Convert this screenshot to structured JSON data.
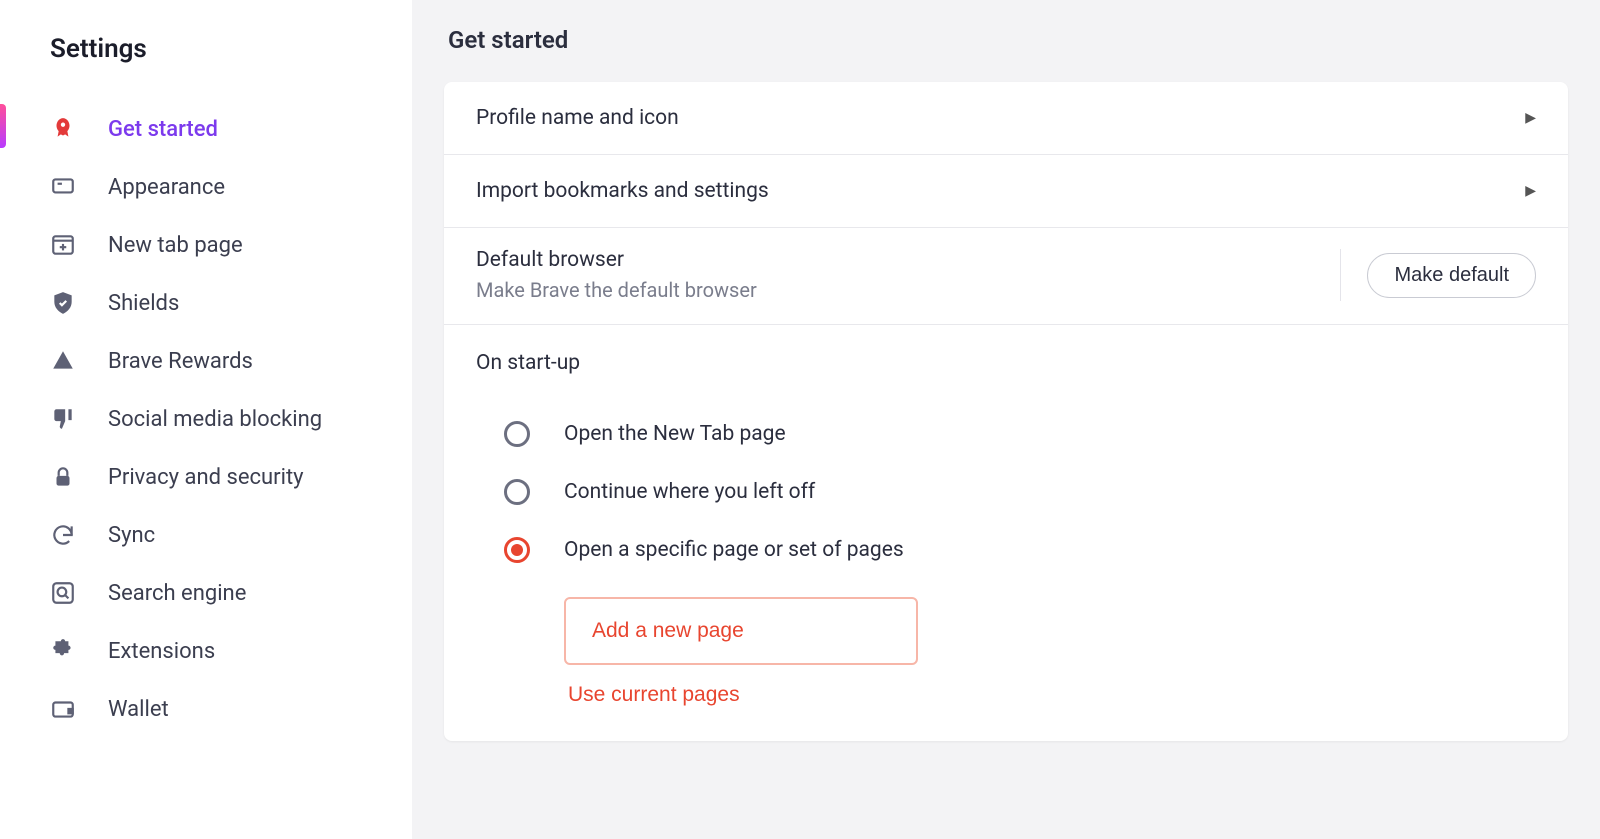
{
  "sidebar": {
    "title": "Settings",
    "items": [
      {
        "label": "Get started"
      },
      {
        "label": "Appearance"
      },
      {
        "label": "New tab page"
      },
      {
        "label": "Shields"
      },
      {
        "label": "Brave Rewards"
      },
      {
        "label": "Social media blocking"
      },
      {
        "label": "Privacy and security"
      },
      {
        "label": "Sync"
      },
      {
        "label": "Search engine"
      },
      {
        "label": "Extensions"
      },
      {
        "label": "Wallet"
      }
    ]
  },
  "page": {
    "title": "Get started"
  },
  "card": {
    "profile_row": "Profile name and icon",
    "import_row": "Import bookmarks and settings",
    "default": {
      "title": "Default browser",
      "sub": "Make Brave the default browser",
      "button": "Make default"
    },
    "startup": {
      "title": "On start-up",
      "options": [
        "Open the New Tab page",
        "Continue where you left off",
        "Open a specific page or set of pages"
      ],
      "add_page": "Add a new page",
      "use_current": "Use current pages"
    }
  }
}
